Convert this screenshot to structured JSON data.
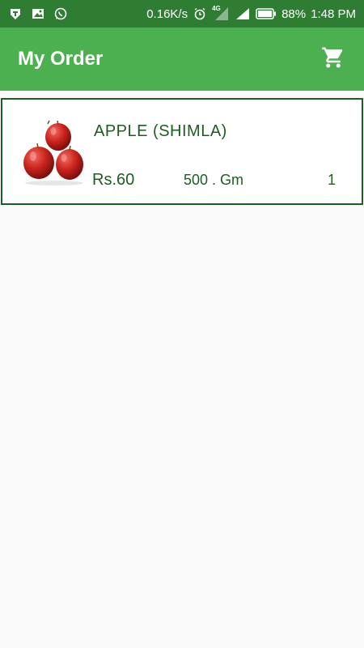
{
  "status_bar": {
    "network_speed": "0.16K/s",
    "network_badge": "4G",
    "battery": "88%",
    "time": "1:48 PM",
    "icons": [
      "vpn-icon",
      "gallery-icon",
      "whatsapp-icon",
      "alarm-icon",
      "signal-icon",
      "signal-icon",
      "battery-icon"
    ]
  },
  "app_bar": {
    "title": "My Order",
    "cart_icon": "shopping-cart-icon"
  },
  "orders": [
    {
      "name": "APPLE (SHIMLA)",
      "price": "Rs.60",
      "weight": "500 . Gm",
      "quantity": "1",
      "image": "apple-image"
    }
  ],
  "colors": {
    "status_bar": "#2e7d32",
    "app_bar": "#4caf50",
    "accent_text": "#1b5e20",
    "background": "#fafafa"
  }
}
